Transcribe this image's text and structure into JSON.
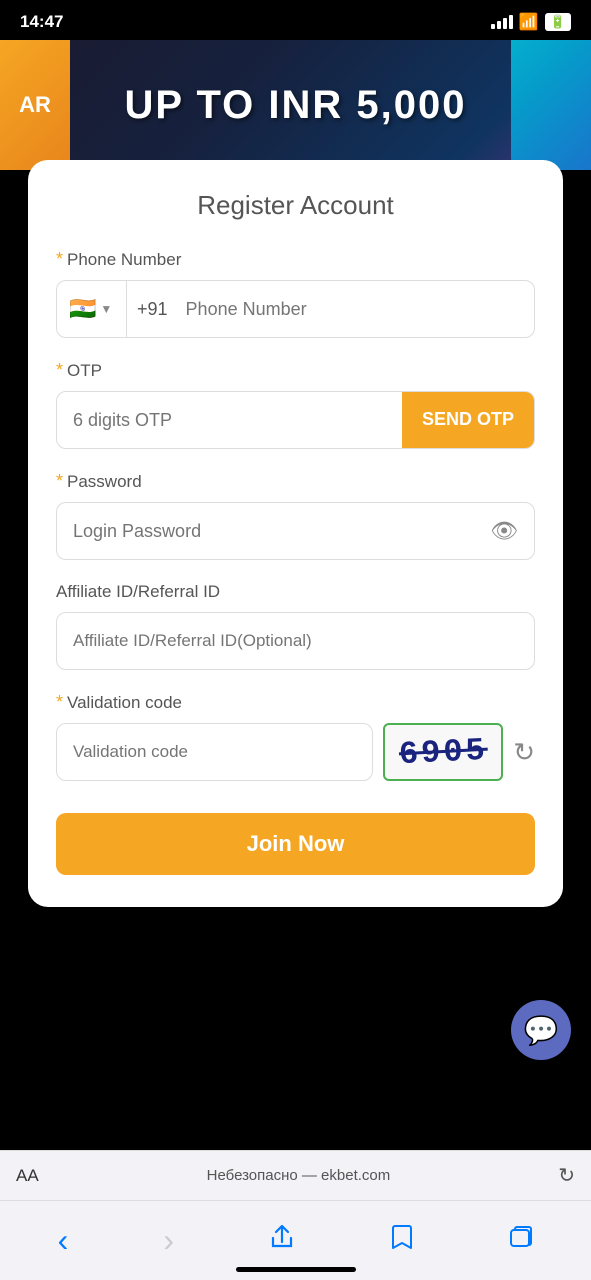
{
  "statusBar": {
    "time": "14:47",
    "signal": "●●●●",
    "wifi": "wifi",
    "battery": "battery"
  },
  "banner": {
    "text": "UP TO INR 5,000",
    "ar_label": "AR",
    "partial_text": "UP TO INR 5,000"
  },
  "form": {
    "title": "Register Account",
    "phone": {
      "label": "Phone Number",
      "required": true,
      "country_code": "+91",
      "flag": "🇮🇳",
      "placeholder": "Phone Number"
    },
    "otp": {
      "label": "OTP",
      "required": true,
      "placeholder": "6 digits OTP",
      "send_button": "SEND OTP"
    },
    "password": {
      "label": "Password",
      "required": true,
      "placeholder": "Login Password"
    },
    "referral": {
      "label": "Affiliate ID/Referral ID",
      "required": false,
      "placeholder": "Affiliate ID/Referral ID(Optional)"
    },
    "validation": {
      "label": "Validation code",
      "required": true,
      "placeholder": "Validation code",
      "captcha_value": "6905"
    },
    "join_button": "Join Now"
  },
  "browser": {
    "aa_label": "AA",
    "url_text": "Небезопасно — ekbet.com",
    "reload": "↻"
  },
  "bottomNav": {
    "back": "‹",
    "forward": "›",
    "share": "share",
    "bookmarks": "bookmarks",
    "tabs": "tabs"
  }
}
